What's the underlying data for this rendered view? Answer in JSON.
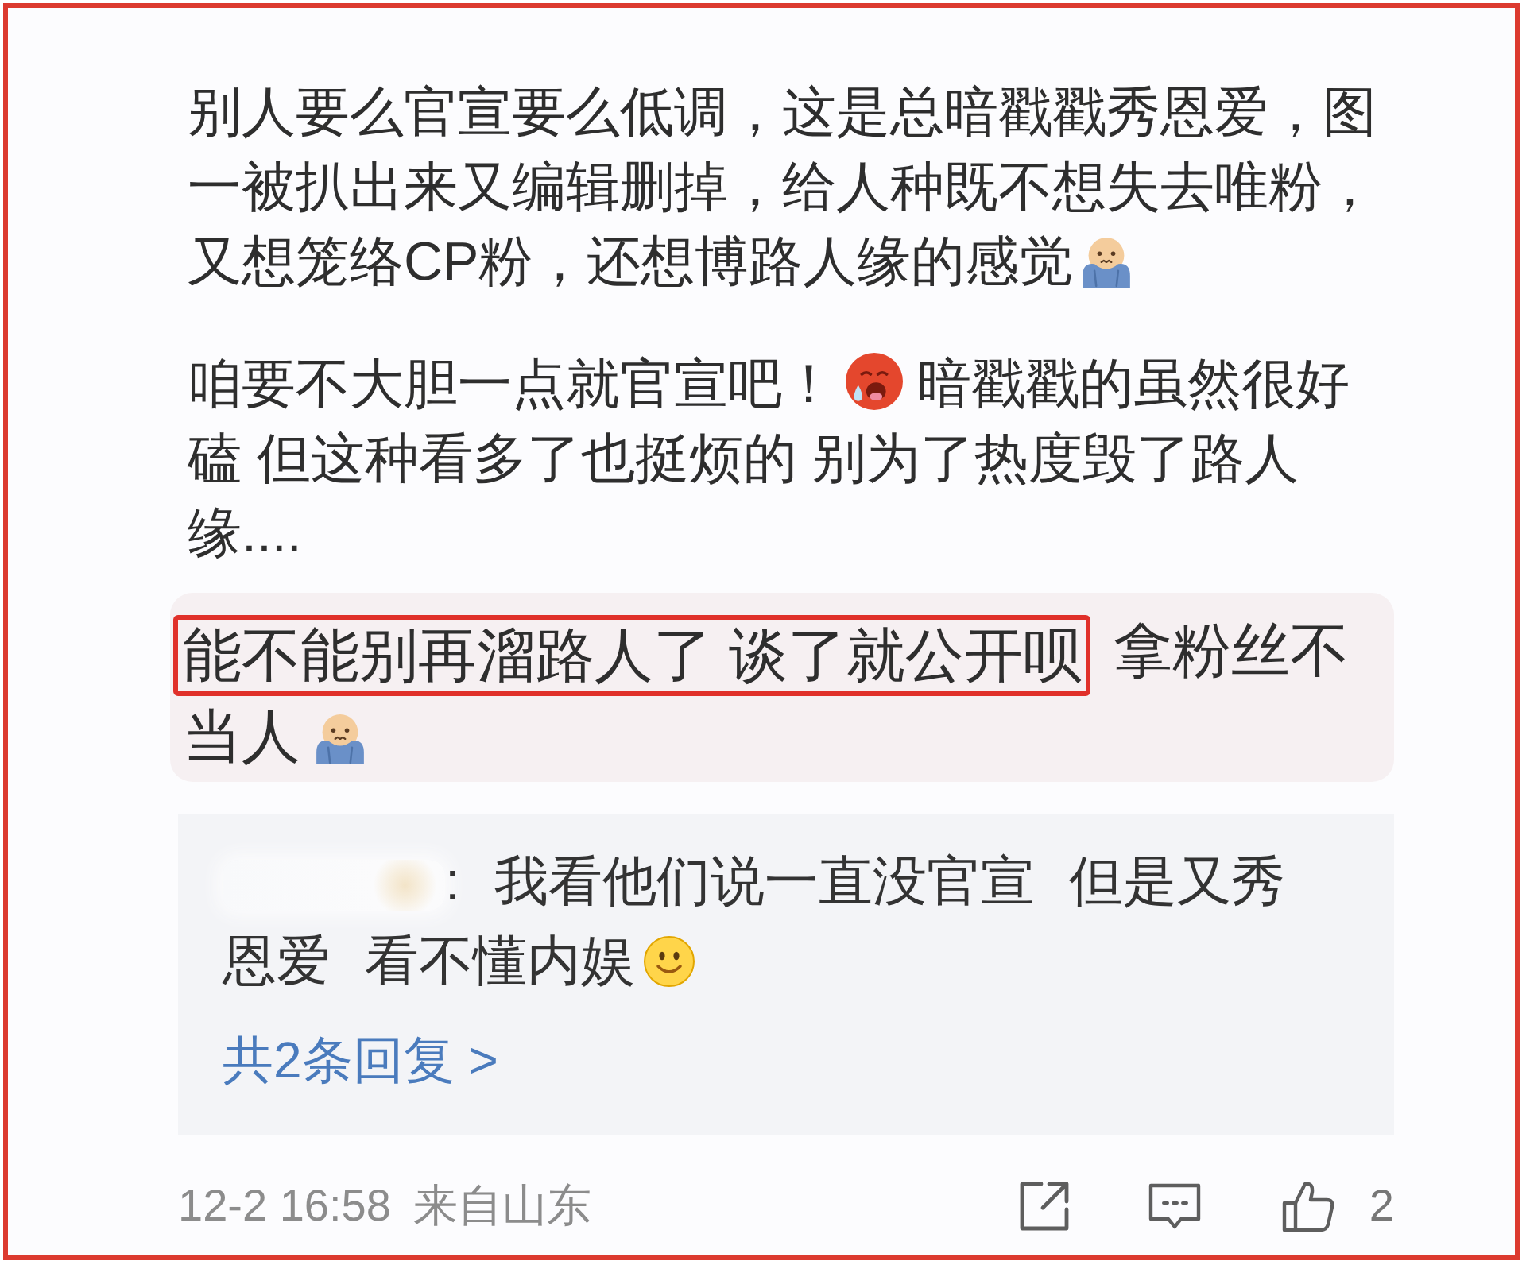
{
  "post": {
    "paragraphs": [
      {
        "lines": [
          {
            "runs": [
              {
                "kind": "text",
                "text": "别人要么官宣要么低调，这是总暗戳戳秀恩爱，图"
              }
            ]
          },
          {
            "runs": [
              {
                "kind": "text",
                "text": "一被扒出来又编辑删掉，给人种既不想失去唯粉，"
              }
            ]
          },
          {
            "runs": [
              {
                "kind": "text",
                "text": "又想笼络CP粉，还想博路人缘的感觉"
              },
              {
                "kind": "cold"
              }
            ]
          }
        ]
      },
      {
        "lines": [
          {
            "runs": [
              {
                "kind": "text",
                "text": "咱要不大胆一点就官宣吧！"
              },
              {
                "kind": "hot"
              },
              {
                "kind": "text",
                "text": "暗戳戳的虽然很好"
              }
            ]
          },
          {
            "runs": [
              {
                "kind": "text",
                "text": "磕 但这种看多了也挺烦的 别为了热度毁了路人"
              }
            ]
          },
          {
            "runs": [
              {
                "kind": "text",
                "text": "缘...."
              }
            ]
          }
        ]
      }
    ]
  },
  "highlight": {
    "lines": [
      {
        "runs": [
          {
            "kind": "text",
            "text": "能不能别再溜路人了 谈了就公开呗",
            "marked": true
          },
          {
            "kind": "text",
            "text": "拿粉丝不",
            "marked": false
          }
        ]
      },
      {
        "runs": [
          {
            "kind": "text",
            "text": "当人",
            "marked": false
          },
          {
            "kind": "cold",
            "marked": false
          }
        ]
      }
    ]
  },
  "reply": {
    "lines": [
      {
        "runs": [
          {
            "kind": "text",
            "text": ": 我看他们说一直没官宣 但是又秀"
          }
        ]
      },
      {
        "runs": [
          {
            "kind": "text",
            "text": "恩爱 看不懂内娱"
          },
          {
            "kind": "smile"
          }
        ]
      }
    ],
    "more_link": "共2条回复 >"
  },
  "footer": {
    "time": "12-2 16:58",
    "location": "来自山东",
    "likes": "2"
  }
}
